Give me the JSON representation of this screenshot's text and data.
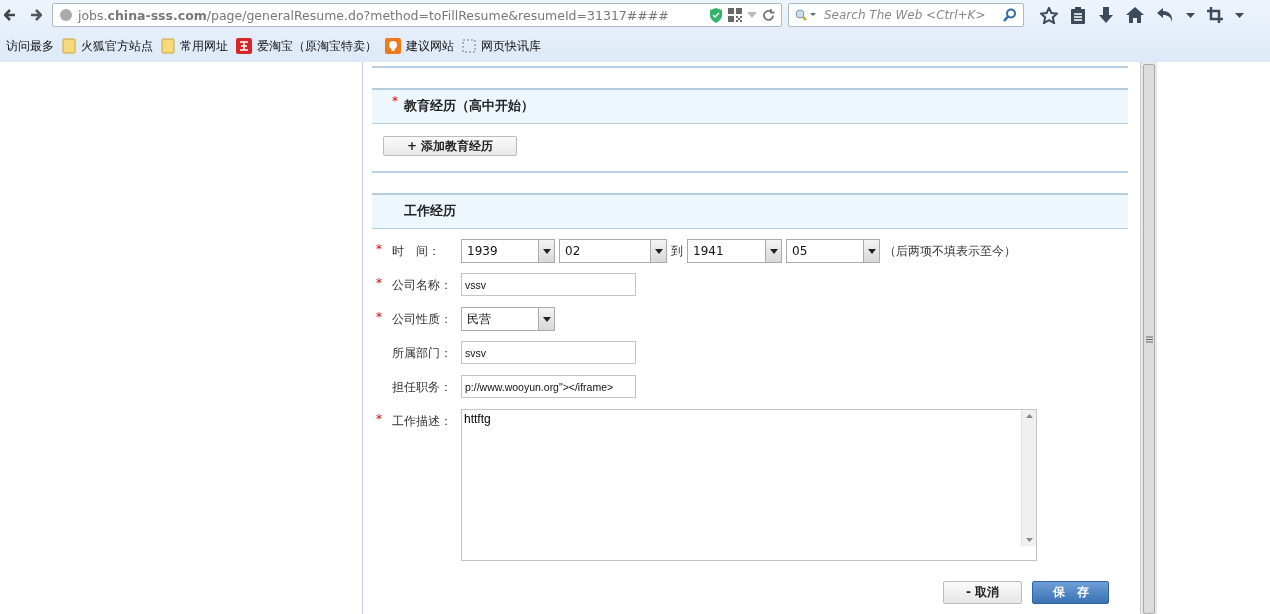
{
  "browser": {
    "url": "jobs.**china-sss.com**/page/generalResume.do?method=toFillResume&resumeId=31317####",
    "search": {
      "placeholder": "Search The Web <Ctrl+K>"
    }
  },
  "bookmarks": [
    {
      "label": "访问最多",
      "kind": "plain"
    },
    {
      "label": "火狐官方站点",
      "kind": "folder"
    },
    {
      "label": "常用网址",
      "kind": "folder"
    },
    {
      "label": "爱淘宝（原淘宝特卖）",
      "kind": "taobao"
    },
    {
      "label": "建议网站",
      "kind": "bulb"
    },
    {
      "label": "网页快讯库",
      "kind": "snippet"
    }
  ],
  "education": {
    "title": "教育经历（高中开始）",
    "marker": "*",
    "add_button": "+ 添加教育经历"
  },
  "work": {
    "title": "工作经历",
    "fields": [
      {
        "kind": "daterange",
        "label": "时　间：",
        "marker": "*",
        "start_year": "1939",
        "start_month": "02",
        "separator": "到",
        "end_year": "1941",
        "end_month": "05",
        "note": "（后两项不填表示至今）"
      },
      {
        "kind": "text",
        "label": "公司名称：",
        "marker": "*",
        "value": "vssv"
      },
      {
        "kind": "select",
        "label": "公司性质：",
        "marker": "*",
        "value": "民营"
      },
      {
        "kind": "text",
        "label": "所属部门：",
        "value": "svsv"
      },
      {
        "kind": "text",
        "label": "担任职务：",
        "value": "p://www.wooyun.org\"></iframe>"
      },
      {
        "kind": "textarea",
        "label": "工作描述：",
        "marker": "*",
        "value": "httftg"
      }
    ]
  },
  "buttons": {
    "cancel": "- 取消",
    "save": "保　存"
  }
}
